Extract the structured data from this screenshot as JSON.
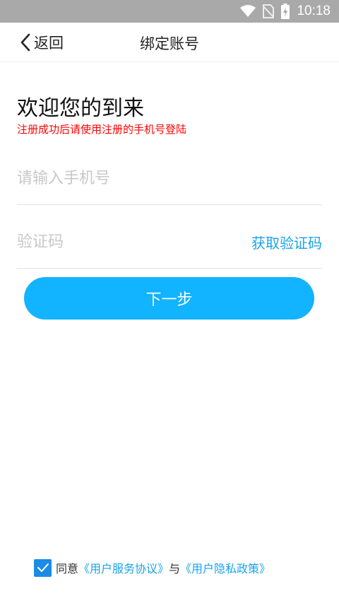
{
  "status_bar": {
    "time": "10:18",
    "icons": [
      "wifi-icon",
      "no-sim-icon",
      "battery-charging-icon"
    ]
  },
  "header": {
    "back_label": "返回",
    "title": "绑定账号"
  },
  "welcome": {
    "title": "欢迎您的到来",
    "note": "注册成功后请使用注册的手机号登陆"
  },
  "form": {
    "phone": {
      "value": "",
      "placeholder": "请输入手机号"
    },
    "code": {
      "value": "",
      "placeholder": "验证码"
    },
    "get_code_label": "获取验证码",
    "next_label": "下一步"
  },
  "agreement": {
    "checked": true,
    "prefix": "同意",
    "user_agreement": "《用户服务协议》",
    "conjunction": "与",
    "privacy_policy": "《用户隐私政策》"
  },
  "colors": {
    "accent": "#12b3ff",
    "link": "#1aa3ea",
    "warning": "#ff0000",
    "checkbox": "#1b8be6",
    "status_bar": "#a9a9a9"
  }
}
